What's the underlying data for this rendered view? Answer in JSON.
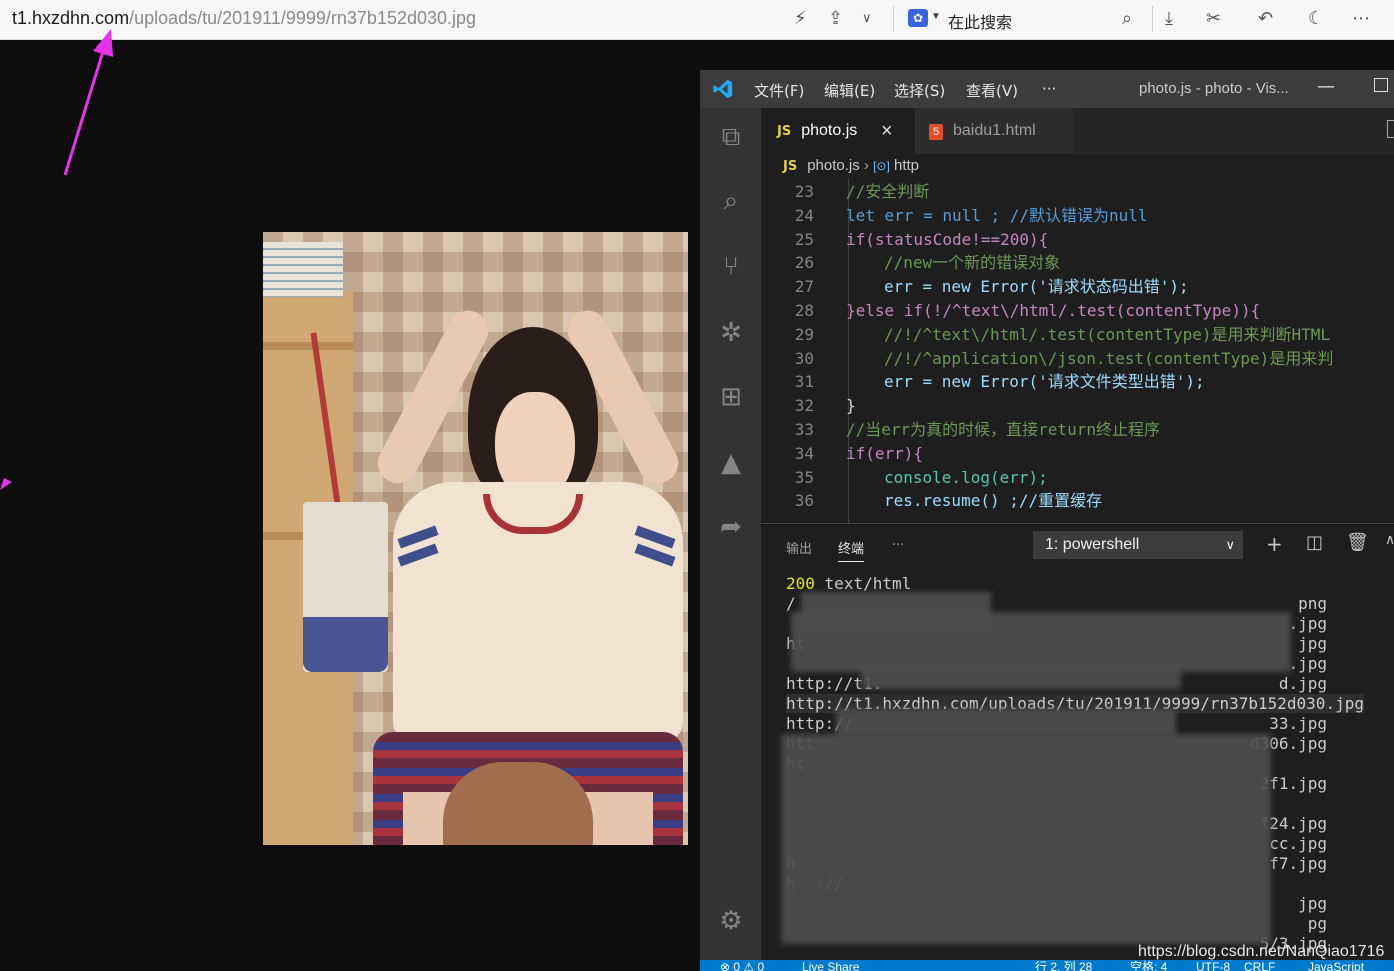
{
  "browser": {
    "url_host": "t1.hxzdhn.com",
    "url_path": "/uploads/tu/201911/9999/rn37b152d030.jpg",
    "search_placeholder": "在此搜索"
  },
  "vscode": {
    "menus": [
      "文件(F)",
      "编辑(E)",
      "选择(S)",
      "查看(V)",
      "···"
    ],
    "window_title": "photo.js - photo - Vis...",
    "tabs": [
      {
        "badge": "JS",
        "label": "photo.js",
        "close": "×"
      },
      {
        "badge": "5",
        "label": "baidu1.html"
      }
    ],
    "breadcrumb": {
      "file": "photo.js",
      "symbol": "http"
    },
    "code_lines": [
      {
        "num": "23",
        "text": "//安全判断"
      },
      {
        "num": "24",
        "text": "let err = null ; //默认错误为null"
      },
      {
        "num": "25",
        "text": "if(statusCode!==200){"
      },
      {
        "num": "26",
        "text": "//new一个新的错误对象"
      },
      {
        "num": "27",
        "text": "err = new Error('请求状态码出错');"
      },
      {
        "num": "28",
        "text": "}else if(!/^text\\/html/.test(contentType)){"
      },
      {
        "num": "29",
        "text": "//!/^text\\/html/.test(contentType)是用来判断HTML"
      },
      {
        "num": "30",
        "text": "//!/^application\\/json.test(contentType)是用来判"
      },
      {
        "num": "31",
        "text": "err = new Error('请求文件类型出错');"
      },
      {
        "num": "32",
        "text": "}"
      },
      {
        "num": "33",
        "text": "//当err为真的时候，直接return终止程序"
      },
      {
        "num": "34",
        "text": "if(err){"
      },
      {
        "num": "35",
        "text": "console.log(err);"
      },
      {
        "num": "36",
        "text": "res.resume() ;//重置缓存"
      }
    ],
    "panel": {
      "tabs": [
        "输出",
        "终端",
        "···"
      ],
      "shell": "1: powershell",
      "terminal_status_code": "200",
      "terminal_content_type": "text/html",
      "terminal_lines": [
        "/",
        "",
        "ht",
        "",
        "http://t1.",
        "http://t1.hxzdhn.com/uploads/tu/201911/9999/rn37b152d030.jpg",
        "http://",
        "htt",
        "ht",
        "",
        "",
        "",
        "",
        "h",
        "h  ://",
        "",
        "",
        ""
      ],
      "terminal_tails": [
        "png",
        ".jpg",
        "jpg",
        ".jpg",
        "d.jpg",
        "",
        "33.jpg",
        "d306.jpg",
        "",
        "2f1.jpg",
        "",
        "f24.jpg",
        "cc.jpg",
        "f7.jpg",
        "",
        "jpg",
        "pg",
        "5/3.jpg"
      ]
    },
    "status": {
      "left": "⊗ 0 ⚠ 0",
      "live_share": "Live Share",
      "position": "行 2, 列 28",
      "spaces": "空格: 4",
      "encoding": "UTF-8",
      "eol": "CRLF",
      "language": "JavaScript"
    }
  },
  "watermark": "https://blog.csdn.net/NanQiao1716",
  "colors": {
    "annotation_arrow": "#e433e8",
    "vscode_status": "#007acc"
  }
}
